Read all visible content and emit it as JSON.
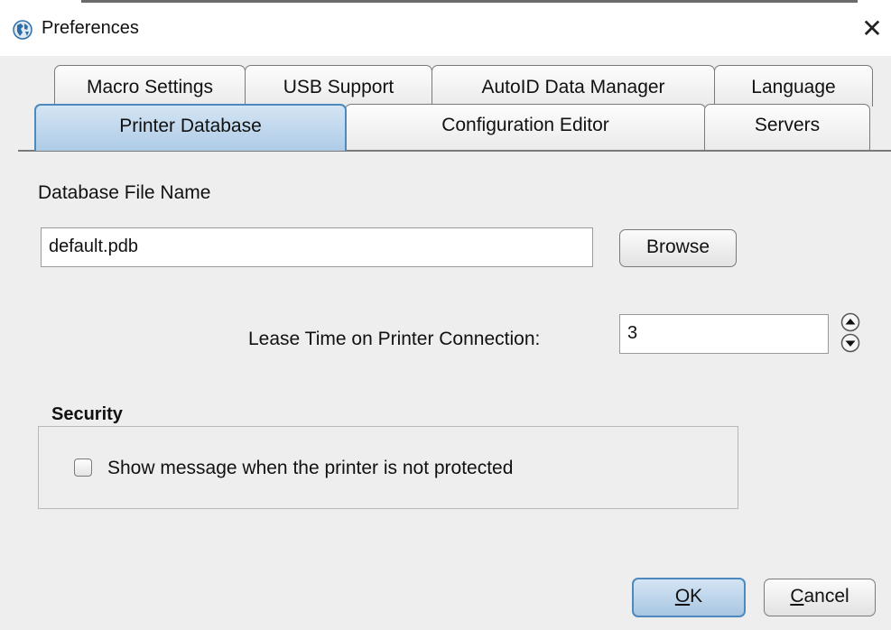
{
  "window": {
    "title": "Preferences",
    "app_icon": "globe-app-icon",
    "close_glyph": "✕"
  },
  "tabs": {
    "row1": [
      "Macro Settings",
      "USB Support",
      "AutoID Data Manager",
      "Language"
    ],
    "row2": [
      "Printer Database",
      "Configuration Editor",
      "Servers"
    ],
    "selected": "Printer Database"
  },
  "database": {
    "label": "Database File Name",
    "file_name": "default.pdb",
    "browse_label": "Browse"
  },
  "lease": {
    "label": "Lease Time on Printer Connection:",
    "value": "3"
  },
  "security": {
    "title": "Security",
    "checkbox_label": "Show message when the printer is not protected",
    "checked": false
  },
  "buttons": {
    "ok_mnemonic": "O",
    "ok_rest": "K",
    "cancel_mnemonic": "C",
    "cancel_rest": "ancel"
  },
  "colors": {
    "selected_tab": "#aecbe6",
    "accent_border": "#4e89bd",
    "background": "#eeeeee"
  }
}
